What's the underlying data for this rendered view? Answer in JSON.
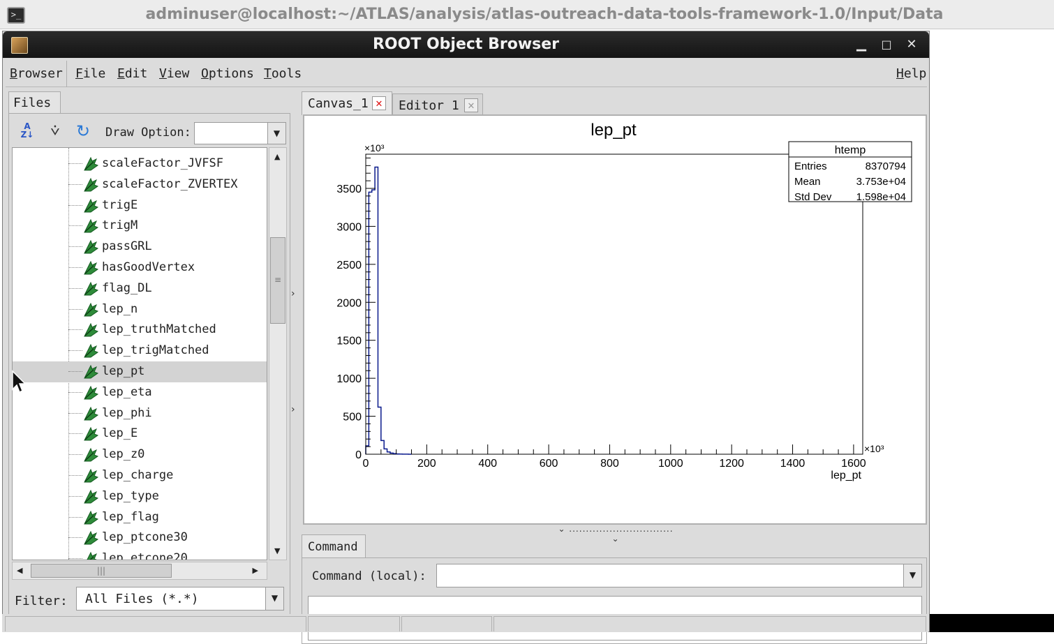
{
  "terminal": {
    "title": "adminuser@localhost:~/ATLAS/analysis/atlas-outreach-data-tools-framework-1.0/Input/Data",
    "icon": "terminal-icon"
  },
  "window": {
    "title": "ROOT Object Browser",
    "controls": [
      "minimize",
      "maximize",
      "close"
    ]
  },
  "menubar": {
    "items": [
      {
        "label": "Browser",
        "underline": "B"
      },
      {
        "label": "File",
        "underline": "F"
      },
      {
        "label": "Edit",
        "underline": "E"
      },
      {
        "label": "View",
        "underline": "V"
      },
      {
        "label": "Options",
        "underline": "O"
      },
      {
        "label": "Tools",
        "underline": "T"
      },
      {
        "label": "Help",
        "underline": "H"
      }
    ]
  },
  "left_panel": {
    "tab": "Files",
    "draw_option_label": "Draw Option:",
    "draw_option_value": "",
    "tree_items": [
      "scaleFactor_JVFSF",
      "scaleFactor_ZVERTEX",
      "trigE",
      "trigM",
      "passGRL",
      "hasGoodVertex",
      "flag_DL",
      "lep_n",
      "lep_truthMatched",
      "lep_trigMatched",
      "lep_pt",
      "lep_eta",
      "lep_phi",
      "lep_E",
      "lep_z0",
      "lep_charge",
      "lep_type",
      "lep_flag",
      "lep_ptcone30",
      "lep_etcone20"
    ],
    "selected_item": "lep_pt",
    "filter_label": "Filter:",
    "filter_value": "All Files (*.*)"
  },
  "tabs": {
    "canvas": "Canvas_1",
    "editor": "Editor 1"
  },
  "chart_data": {
    "type": "bar",
    "title": "lep_pt",
    "xlabel": "lep_pt",
    "ylabel": "",
    "x_exponent": "×10³",
    "y_exponent": "×10³",
    "xlim": [
      0,
      1630
    ],
    "ylim": [
      0,
      3950
    ],
    "x_ticks": [
      0,
      200,
      400,
      600,
      800,
      1000,
      1200,
      1400,
      1600
    ],
    "y_ticks": [
      0,
      500,
      1000,
      1500,
      2000,
      2500,
      3000,
      3500
    ],
    "bin_width": 10,
    "bins": [
      {
        "x": 0,
        "value": 110
      },
      {
        "x": 10,
        "value": 3450
      },
      {
        "x": 20,
        "value": 3480
      },
      {
        "x": 30,
        "value": 3780
      },
      {
        "x": 40,
        "value": 620
      },
      {
        "x": 50,
        "value": 180
      },
      {
        "x": 60,
        "value": 70
      },
      {
        "x": 70,
        "value": 30
      },
      {
        "x": 80,
        "value": 15
      },
      {
        "x": 90,
        "value": 8
      },
      {
        "x": 100,
        "value": 4
      },
      {
        "x": 110,
        "value": 2
      },
      {
        "x": 120,
        "value": 1
      },
      {
        "x": 130,
        "value": 1
      },
      {
        "x": 140,
        "value": 0
      }
    ],
    "stats": {
      "name": "htemp",
      "rows": [
        {
          "label": "Entries",
          "value": "8370794"
        },
        {
          "label": "Mean",
          "value": "3.753e+04"
        },
        {
          "label": "Std Dev",
          "value": "1.598e+04"
        }
      ]
    },
    "line_color": "#0a1a8c"
  },
  "command": {
    "tab": "Command",
    "label": "Command (local):",
    "value": ""
  }
}
